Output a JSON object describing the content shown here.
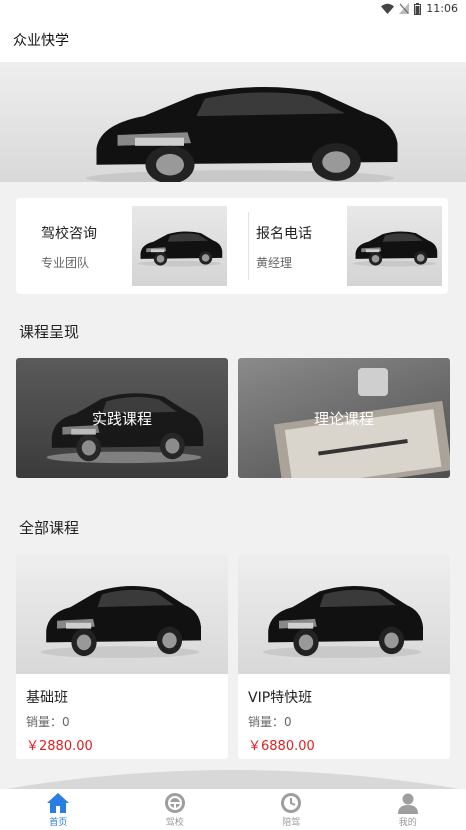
{
  "status": {
    "time": "11:06"
  },
  "app": {
    "title": "众业快学"
  },
  "info": [
    {
      "title": "驾校咨询",
      "subtitle": "专业团队"
    },
    {
      "title": "报名电话",
      "subtitle": "黄经理"
    }
  ],
  "sections": {
    "showcase": "课程呈现",
    "all": "全部课程"
  },
  "categories": [
    {
      "label": "实践课程"
    },
    {
      "label": "理论课程"
    }
  ],
  "courses": [
    {
      "name": "基础班",
      "sales": "销量：0",
      "price": "￥2880.00"
    },
    {
      "name": "VIP特快班",
      "sales": "销量：0",
      "price": "￥6880.00"
    }
  ],
  "tabs": [
    {
      "label": "首页",
      "icon": "home-icon"
    },
    {
      "label": "驾校",
      "icon": "steering-wheel-icon"
    },
    {
      "label": "陪驾",
      "icon": "clock-icon"
    },
    {
      "label": "我的",
      "icon": "user-icon"
    }
  ],
  "colors": {
    "accent": "#2a7de1",
    "price": "#e02020",
    "background": "#f1f1f1"
  }
}
